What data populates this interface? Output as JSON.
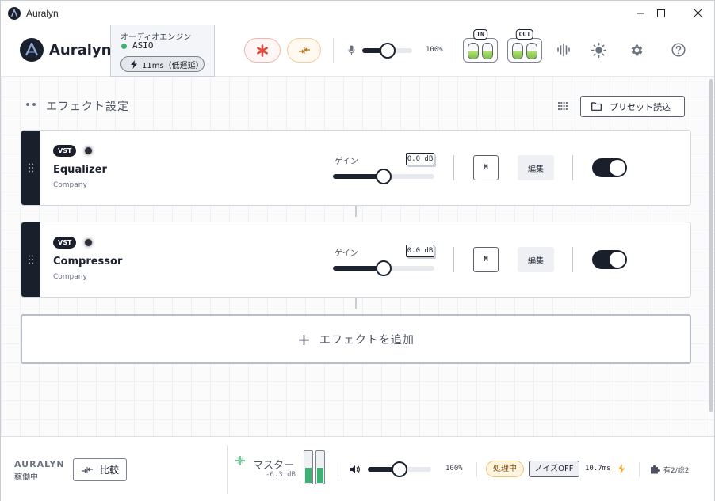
{
  "window": {
    "title": "Auralyn"
  },
  "header": {
    "brand": "Auralyn",
    "engine": {
      "label": "オーディオエンジン",
      "name": "ASIO",
      "latency": "11ms（低遅延）"
    },
    "input_gain_pct": "100%",
    "meters": {
      "in_label": "IN",
      "out_label": "OUT"
    }
  },
  "main": {
    "section_title": "エフェクト設定",
    "preset_button": "プリセット読込",
    "effects": [
      {
        "badge": "VST",
        "name": "Equalizer",
        "company": "Company",
        "gain_label": "ゲイン",
        "gain_value": "0.0 dB",
        "mute_label": "M",
        "edit_label": "編集",
        "enabled": true
      },
      {
        "badge": "VST",
        "name": "Compressor",
        "company": "Company",
        "gain_label": "ゲイン",
        "gain_value": "0.0 dB",
        "mute_label": "M",
        "edit_label": "編集",
        "enabled": true
      }
    ],
    "add_effect": "エフェクトを追加"
  },
  "footer": {
    "brand": "AURALYN",
    "status": "稼働中",
    "compare": "比較",
    "master_label": "マスター",
    "master_db": "-6.3 dB",
    "volume_pct": "100%",
    "processing": "処理中",
    "noise": "ノイズOFF",
    "latency": "10.7ms",
    "plugins": "有2/総2"
  },
  "colors": {
    "accent_dark": "#1a1f2c",
    "active_green": "#3bb273",
    "record_red": "#e5483b",
    "warning_amber": "#f0a830"
  }
}
